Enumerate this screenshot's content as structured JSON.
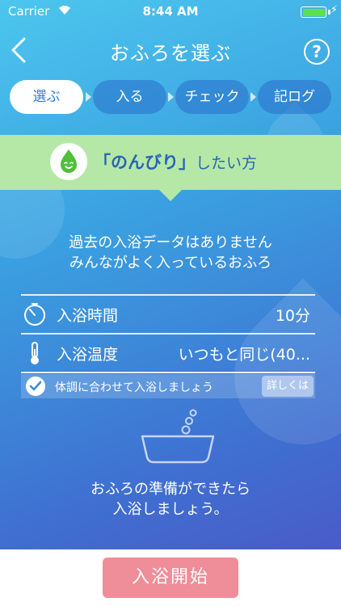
{
  "status_bar": {
    "carrier": "Carrier",
    "time": "8:44 AM"
  },
  "nav": {
    "title": "おふろを選ぶ",
    "help_label": "?"
  },
  "steps": [
    {
      "label": "選ぶ",
      "active": true
    },
    {
      "label": "入る",
      "active": false
    },
    {
      "label": "チェック",
      "active": false
    },
    {
      "label": "記ログ",
      "active": false
    }
  ],
  "banner": {
    "quote": "「のんびり」",
    "suffix": "したい方"
  },
  "message": {
    "line1": "過去の入浴データはありません",
    "line2": "みんながよく入っているおふろ"
  },
  "bath_time": {
    "label": "入浴時間",
    "value": "10分"
  },
  "bath_temp": {
    "label": "入浴温度",
    "value": "いつもと同じ(40..."
  },
  "advice": {
    "text": "体調に合わせて入浴しましょう",
    "details_label": "詳しくは"
  },
  "prompt": {
    "line1": "おふろの準備ができたら",
    "line2": "入浴しましょう。"
  },
  "start_button": {
    "label": "入浴開始"
  },
  "colors": {
    "accent_green": "#b5e8a6",
    "button_pink": "#ef8d98",
    "active_step_text": "#2d7fd8"
  }
}
